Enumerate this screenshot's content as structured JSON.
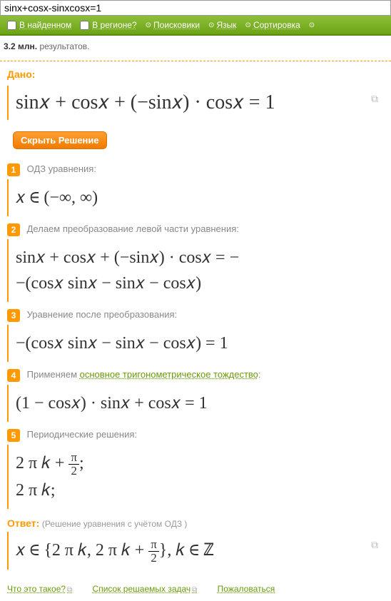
{
  "search": {
    "value": "sinx+cosx-sinxcosx=1"
  },
  "filters": {
    "inFound": "В найденном",
    "inRegion": "В регионе?",
    "engines": "Поисковики",
    "language": "Язык",
    "sorting": "Сортировка"
  },
  "resultsCount": {
    "count": "3.2 млн.",
    "label": "результатов."
  },
  "given": {
    "label": "Дано:",
    "formula": "sin𝑥 + cos𝑥 + (−sin𝑥) · cos𝑥 = 1"
  },
  "hideSolution": "Скрыть Решение",
  "steps": [
    {
      "num": "1",
      "title": "ОДЗ уравнения:",
      "formula": "𝑥 ∈  (−∞, ∞)"
    },
    {
      "num": "2",
      "title": "Делаем преобразование левой части уравнения:",
      "lines": [
        "sin𝑥 + cos𝑥 + (−sin𝑥) · cos𝑥 = −",
        "−(cos𝑥 sin𝑥 − sin𝑥 − cos𝑥)"
      ]
    },
    {
      "num": "3",
      "title": "Уравнение после преобразования:",
      "formula": "−(cos𝑥 sin𝑥 − sin𝑥 − cos𝑥) = 1"
    },
    {
      "num": "4",
      "titlePrefix": "Применяем ",
      "titleLink": "основное тригонометрическое тождество",
      "titleSuffix": ":",
      "formula": "(1 − cos𝑥) · sin𝑥 + cos𝑥 = 1"
    },
    {
      "num": "5",
      "title": "Периодические решения:",
      "periodic": {
        "prefix1": "2 π 𝑘 + ",
        "fracNum": "π",
        "fracDen": "2",
        "suffix1": ";",
        "line2": "2 π 𝑘;"
      }
    }
  ],
  "answer": {
    "label": "Ответ:",
    "note": "(Решение уравнения с учётом ОДЗ )",
    "parts": {
      "pre": "𝑥 ∈  {2 π 𝑘, 2 π 𝑘 + ",
      "fracNum": "π",
      "fracDen": "2",
      "post": "},  𝑘 ∈  ℤ"
    }
  },
  "footer": {
    "link1": "Что это такое?",
    "link2": "Список решаемых задач",
    "link3": "Пожаловаться"
  }
}
